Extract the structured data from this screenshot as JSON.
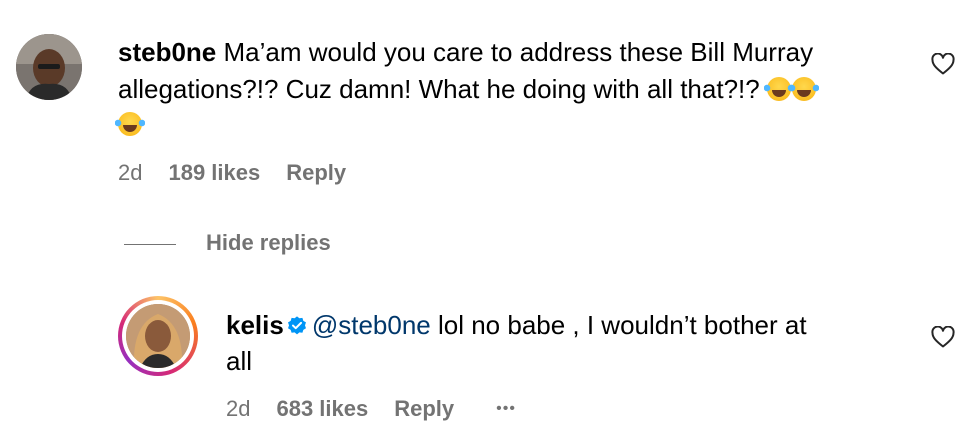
{
  "comments": [
    {
      "username": "steb0ne",
      "text_line1": "Ma’am would you care to address these Bill Murray",
      "text_line2": "allegations?!? Cuz damn! What he doing with all that?!?",
      "emoji": "😂",
      "age": "2d",
      "likes": "189 likes",
      "reply_label": "Reply"
    }
  ],
  "hide_replies_label": "Hide replies",
  "reply": {
    "username": "kelis",
    "verified": true,
    "mention": "@steb0ne",
    "text_line1": " lol no babe , I wouldn’t bother at",
    "text_line2": "all",
    "age": "2d",
    "likes": "683 likes",
    "reply_label": "Reply",
    "more_label": "•••"
  },
  "colors": {
    "meta": "#737373",
    "mention": "#00376b",
    "verified": "#0095f6"
  }
}
